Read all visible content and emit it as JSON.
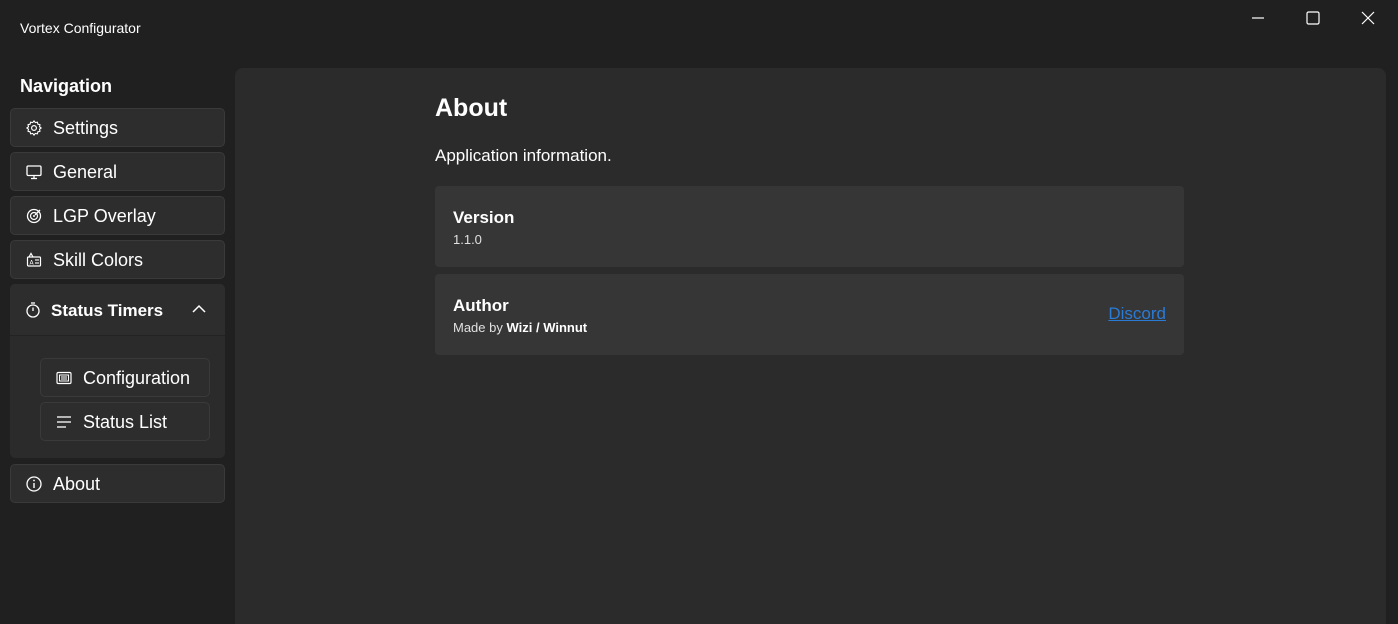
{
  "window": {
    "title": "Vortex Configurator"
  },
  "sidebar": {
    "heading": "Navigation",
    "items": [
      {
        "label": "Settings",
        "icon": "gear-icon"
      },
      {
        "label": "General",
        "icon": "monitor-icon"
      },
      {
        "label": "LGP Overlay",
        "icon": "overlay-icon"
      },
      {
        "label": "Skill Colors",
        "icon": "skill-colors-icon"
      }
    ],
    "group": {
      "label": "Status Timers",
      "icon": "timer-icon",
      "expanded": true,
      "children": [
        {
          "label": "Configuration",
          "icon": "configuration-icon"
        },
        {
          "label": "Status List",
          "icon": "list-icon"
        }
      ]
    },
    "about": {
      "label": "About",
      "icon": "info-icon"
    }
  },
  "page": {
    "title": "About",
    "description": "Application information.",
    "version_card": {
      "title": "Version",
      "value": "1.1.0"
    },
    "author_card": {
      "title": "Author",
      "prefix": "Made by",
      "name": "Wizi / Winnut",
      "link": "Discord"
    }
  },
  "colors": {
    "background": "#202020",
    "panel": "#2b2b2b",
    "card": "#363636",
    "link": "#2a7bd6"
  }
}
